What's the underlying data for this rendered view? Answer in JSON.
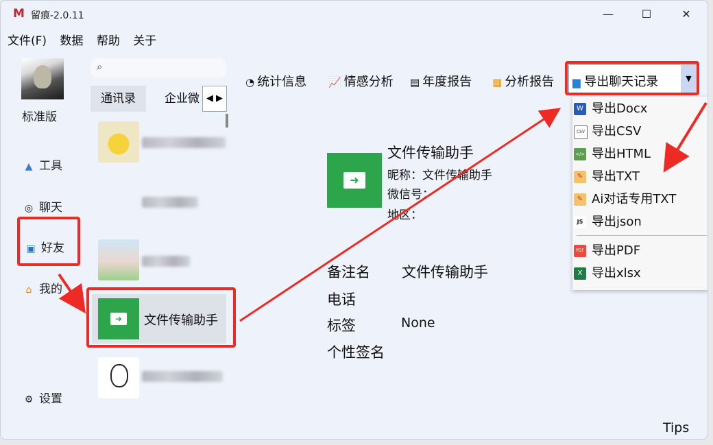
{
  "window": {
    "logo": "M",
    "title": "留痕-2.0.11",
    "controls": {
      "minimize": "—",
      "maximize": "☐",
      "close": "✕"
    }
  },
  "menubar": [
    "文件(F)",
    "数据",
    "帮助",
    "关于"
  ],
  "sidebar": {
    "edition": "标准版",
    "items": [
      {
        "label": "工具",
        "icon": "tools-icon"
      },
      {
        "label": "聊天",
        "icon": "chat-icon"
      },
      {
        "label": "好友",
        "icon": "contacts-icon"
      },
      {
        "label": "我的",
        "icon": "home-icon"
      },
      {
        "label": "设置",
        "icon": "gear-icon"
      }
    ]
  },
  "contact_panel": {
    "tabs": [
      "通讯录",
      "企业微"
    ],
    "contacts": [
      {
        "name": "",
        "blurred": true
      },
      {
        "name": "",
        "blurred": true
      },
      {
        "name": "",
        "blurred": true
      },
      {
        "name": "文件传输助手",
        "blurred": false,
        "selected": true
      },
      {
        "name": "",
        "blurred": true
      }
    ]
  },
  "toolbar": {
    "stats": "统计信息",
    "sentiment": "情感分析",
    "annual": "年度报告",
    "analysis": "分析报告",
    "export": "导出聊天记录"
  },
  "export_menu": [
    "导出Docx",
    "导出CSV",
    "导出HTML",
    "导出TXT",
    "Ai对话专用TXT",
    "导出json",
    "导出PDF",
    "导出xlsx"
  ],
  "export_menu_icons": {
    "docx": "W",
    "csv": "CSV",
    "html": "</>",
    "json": "JS",
    "pdf": "PDF",
    "xlsx": "X"
  },
  "profile": {
    "name": "文件传输助手",
    "nickname": "昵称：文件传输助手",
    "wechat_id": "微信号：",
    "region": "地区：",
    "remark_label": "备注名",
    "remark_value": "文件传输助手",
    "phone_label": "电话",
    "tag_label": "标签",
    "tag_value": "None",
    "signature_label": "个性签名"
  },
  "tips": "Tips",
  "colors": {
    "accent_red": "#ee2a24",
    "file_transfer_green": "#2da54b",
    "background": "#eef2fa"
  }
}
